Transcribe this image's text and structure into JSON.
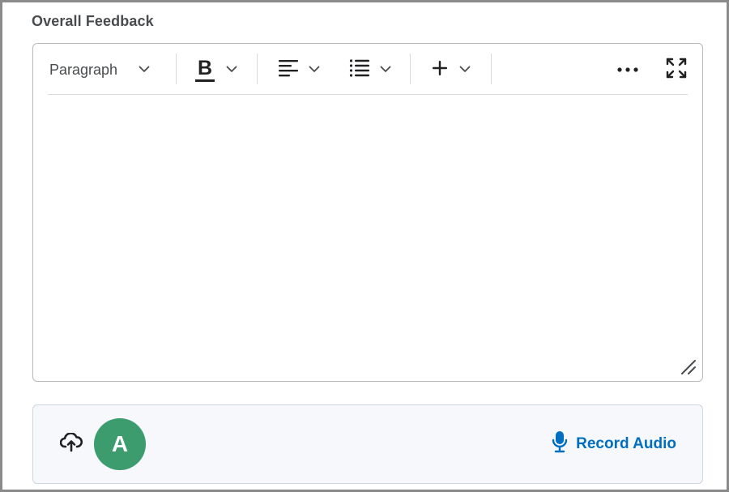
{
  "section": {
    "title": "Overall Feedback"
  },
  "toolbar": {
    "format_select_value": "Paragraph",
    "bold_label": "B",
    "icons": {
      "format": "chevron-down-icon",
      "bold": "bold-icon",
      "align": "align-left-icon",
      "list": "bulleted-list-icon",
      "insert": "plus-icon",
      "more": "more-horizontal-icon",
      "fullscreen": "fullscreen-icon"
    }
  },
  "editor": {
    "content": ""
  },
  "attachments": {
    "avatar_initial": "A",
    "avatar_color": "#3d9c6e",
    "record_audio_label": "Record Audio",
    "record_color": "#006fbf",
    "icons": {
      "upload": "cloud-upload-icon",
      "record": "microphone-icon"
    }
  }
}
